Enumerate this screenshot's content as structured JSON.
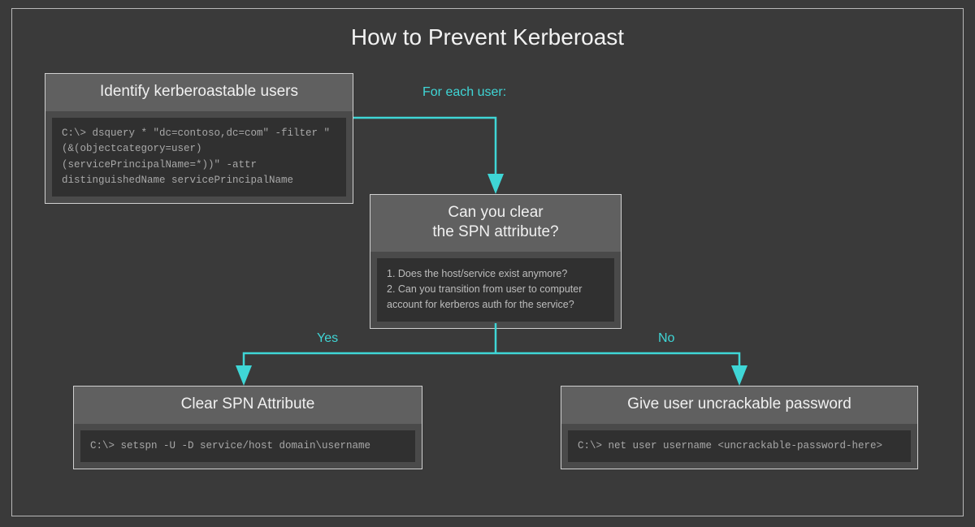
{
  "title": "How to Prevent Kerberoast",
  "identify": {
    "header": "Identify kerberoastable users",
    "code": "C:\\> dsquery * \"dc=contoso,dc=com\" -filter \"(&(objectcategory=user)(servicePrincipalName=*))\" -attr distinguishedName servicePrincipalName"
  },
  "decision": {
    "header_line1": "Can you clear",
    "header_line2": "the SPN attribute?",
    "body": "1. Does the host/service exist anymore?\n2. Can you transition from user to computer account for kerberos auth for the service?"
  },
  "clear": {
    "header": "Clear SPN Attribute",
    "code": "C:\\> setspn -U -D service/host domain\\username"
  },
  "uncrackable": {
    "header": "Give user uncrackable password",
    "code": "C:\\> net user username <uncrackable-password-here>"
  },
  "labels": {
    "for_each": "For each user:",
    "yes": "Yes",
    "no": "No"
  },
  "colors": {
    "accent": "#3fd6d6",
    "bg": "#3a3a3a",
    "node_border": "#d0d0d0"
  }
}
